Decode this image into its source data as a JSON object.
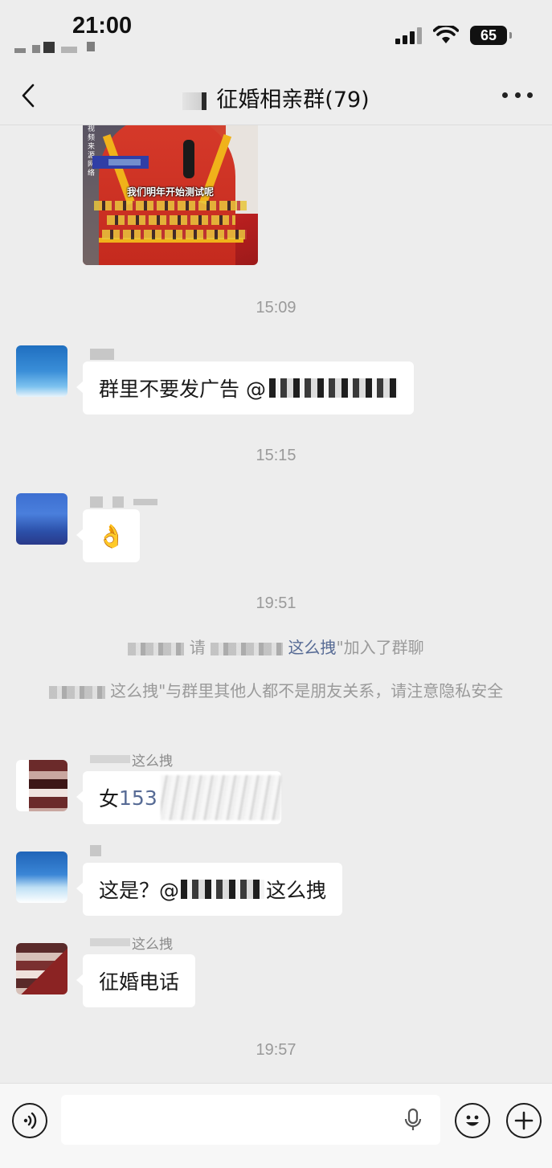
{
  "status_bar": {
    "time": "21:00",
    "battery": "65",
    "icons": [
      "signal-icon",
      "wifi-icon",
      "battery-icon"
    ]
  },
  "nav": {
    "title": "征婚相亲群(79)",
    "back_icon": "chevron-left-icon",
    "more_icon": "more-dots-icon"
  },
  "video_message": {
    "caption": "我们明年开始测试呢",
    "source_label": "视频来源网络"
  },
  "timestamps": [
    "15:09",
    "15:15",
    "19:51",
    "19:57"
  ],
  "messages": [
    {
      "id": "m1",
      "text": "群里不要发广告 @"
    },
    {
      "id": "m2",
      "emoji": "👌"
    },
    {
      "id": "m3",
      "sender_suffix": "这么拽",
      "text_prefix": "女 ",
      "phone_visible": "153"
    },
    {
      "id": "m4",
      "text_prefix": "这是？@",
      "text_suffix": "这么拽"
    },
    {
      "id": "m5",
      "sender_suffix": "这么拽",
      "text": "征婚电话"
    }
  ],
  "system_notes": {
    "join": {
      "invite_word": "请",
      "nick_suffix": "这么拽",
      "action": "\"加入了群聊"
    },
    "privacy": {
      "nick_suffix": "这么拽",
      "text": "\"与群里其他人都不是朋友关系，请注意隐私安全"
    }
  },
  "input_bar": {
    "icons": [
      "voice-icon",
      "microphone-icon",
      "emoji-icon",
      "plus-icon"
    ]
  },
  "colors": {
    "background": "#ededed",
    "bubble": "#ffffff",
    "link": "#576b95",
    "timestamp": "#9a9a9a"
  }
}
